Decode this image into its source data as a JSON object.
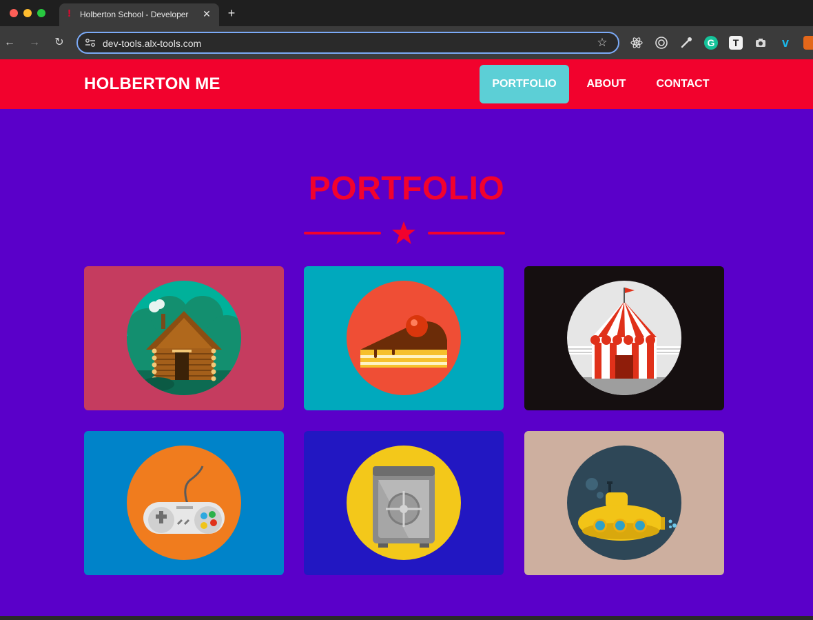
{
  "browser": {
    "tab_title": "Holberton School - Developer",
    "tab_close": "✕",
    "new_tab": "+",
    "url": "dev-tools.alx-tools.com",
    "nav": {
      "back": "←",
      "forward": "→",
      "reload": "↻",
      "bookmark": "☆"
    },
    "extensions": [
      "react-icon",
      "target-icon",
      "eyedropper-icon",
      "grammarly-icon",
      "notion-icon",
      "camera-icon",
      "vimeo-icon",
      "extension-icon"
    ]
  },
  "site": {
    "brand": "HOLBERTON ME",
    "nav": [
      {
        "label": "PORTFOLIO",
        "active": true
      },
      {
        "label": "ABOUT",
        "active": false
      },
      {
        "label": "CONTACT",
        "active": false
      }
    ],
    "accent_color": "#f2022d",
    "background_color": "#5a00c9",
    "active_nav_color": "#5ccfd6"
  },
  "portfolio": {
    "title": "PORTFOLIO",
    "items": [
      {
        "icon": "cabin-icon",
        "bg": "#c53c5f"
      },
      {
        "icon": "cake-icon",
        "bg": "#00a9bd"
      },
      {
        "icon": "circus-tent-icon",
        "bg": "#150f10"
      },
      {
        "icon": "game-controller-icon",
        "bg": "#0083c9"
      },
      {
        "icon": "safe-icon",
        "bg": "#2217c2"
      },
      {
        "icon": "submarine-icon",
        "bg": "#cdaf9f"
      }
    ]
  }
}
